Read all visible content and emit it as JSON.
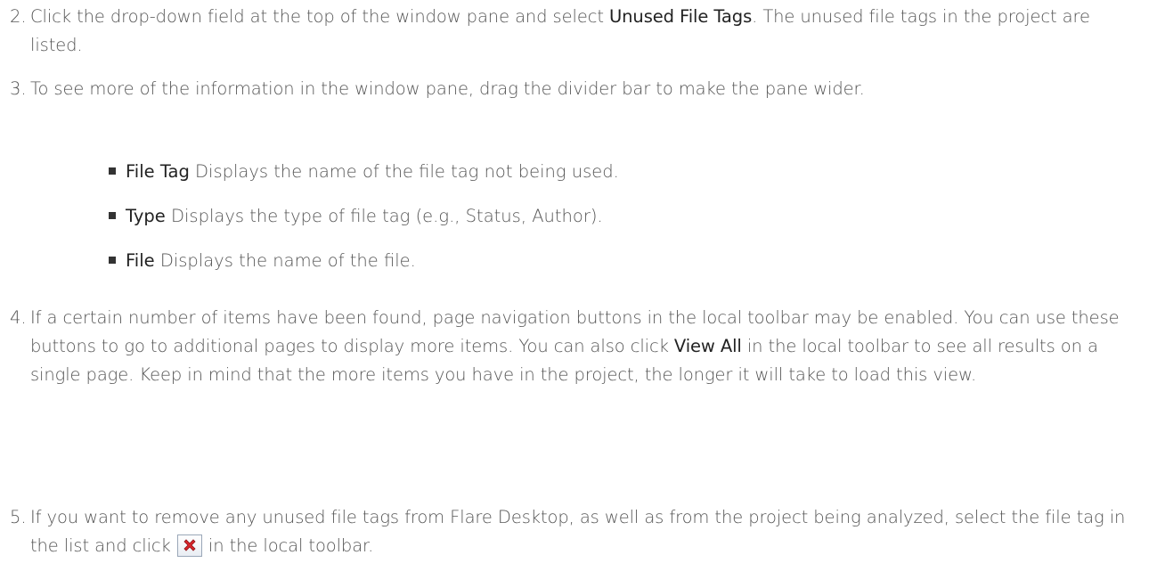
{
  "steps": [
    {
      "number": "2.",
      "pre": "Click the drop-down field at the top of the window pane and select ",
      "strong": "Unused File Tags",
      "post": ". The unused file tags in the project are listed."
    },
    {
      "number": "3.",
      "text": "To see more of the information in the window pane, drag the divider bar to make the pane wider."
    },
    {
      "number": "4.",
      "pre": "If a certain number of items have been found, page navigation buttons in the local toolbar may be enabled. You can use these buttons to go to additional pages to display more items. You can also click ",
      "strong": "View All",
      "post": " in the local toolbar to see all results on a single page. Keep in mind that the more items you have in the project, the longer it will take to load this view."
    },
    {
      "number": "5.",
      "pre": "If you want to remove any unused file tags from Flare Desktop, as well as from the project being analyzed, select the file tag in the list and click ",
      "post": " in the local toolbar.",
      "icon": "delete-x-icon"
    }
  ],
  "bullets": [
    {
      "term": "File Tag",
      "description": " Displays the name of the file tag not being used."
    },
    {
      "term": "Type",
      "description": " Displays the type of file tag (e.g., Status, Author)."
    },
    {
      "term": "File",
      "description": " Displays the name of the file."
    }
  ],
  "colors": {
    "text": "#555555",
    "strong": "#222222",
    "icon_x": "#d9262b"
  }
}
